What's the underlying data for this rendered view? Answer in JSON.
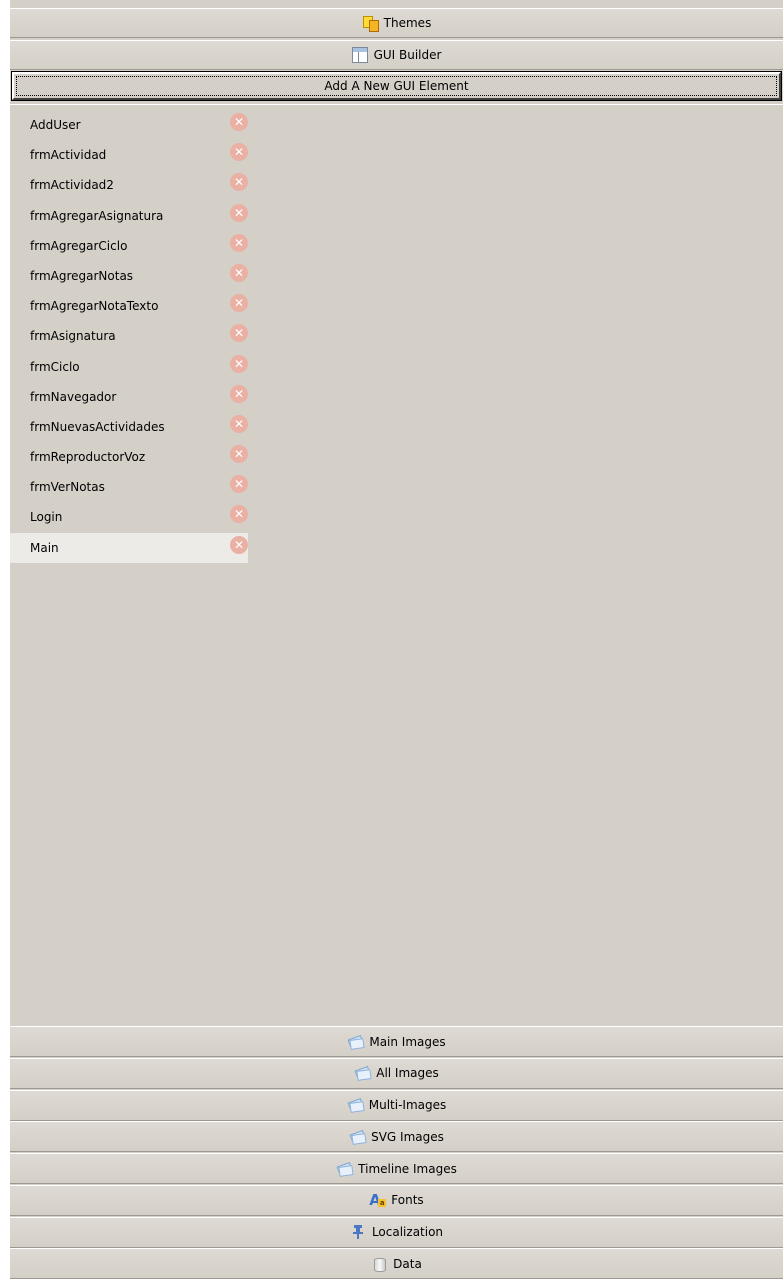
{
  "accordion_top": [
    {
      "key": "themes",
      "label": "Themes",
      "icon": "themes-icon"
    },
    {
      "key": "gui_builder",
      "label": "GUI Builder",
      "icon": "gui-builder-icon"
    }
  ],
  "add_button": {
    "label": "Add A New GUI Element"
  },
  "gui_elements": [
    {
      "label": "AddUser",
      "selected": false
    },
    {
      "label": "frmActividad",
      "selected": false
    },
    {
      "label": "frmActividad2",
      "selected": false
    },
    {
      "label": "frmAgregarAsignatura",
      "selected": false
    },
    {
      "label": "frmAgregarCiclo",
      "selected": false
    },
    {
      "label": "frmAgregarNotas",
      "selected": false
    },
    {
      "label": "frmAgregarNotaTexto",
      "selected": false
    },
    {
      "label": "frmAsignatura",
      "selected": false
    },
    {
      "label": "frmCiclo",
      "selected": false
    },
    {
      "label": "frmNavegador",
      "selected": false
    },
    {
      "label": "frmNuevasActividades",
      "selected": false
    },
    {
      "label": "frmReproductorVoz",
      "selected": false
    },
    {
      "label": "frmVerNotas",
      "selected": false
    },
    {
      "label": "Login",
      "selected": false
    },
    {
      "label": "Main",
      "selected": true
    }
  ],
  "delete_glyph": "✕",
  "accordion_bottom": [
    {
      "key": "main_images",
      "label": "Main Images",
      "icon": "images-icon"
    },
    {
      "key": "all_images",
      "label": "All Images",
      "icon": "images-icon"
    },
    {
      "key": "multi_images",
      "label": "Multi-Images",
      "icon": "images-icon"
    },
    {
      "key": "svg_images",
      "label": "SVG Images",
      "icon": "images-icon"
    },
    {
      "key": "timeline_images",
      "label": "Timeline Images",
      "icon": "images-icon"
    },
    {
      "key": "fonts",
      "label": "Fonts",
      "icon": "fonts-icon"
    },
    {
      "key": "localization",
      "label": "Localization",
      "icon": "pin-icon"
    },
    {
      "key": "data",
      "label": "Data",
      "icon": "data-icon"
    }
  ],
  "colors": {
    "panel_bg": "#d4d0c8",
    "selected_row": "#ecebe7",
    "delete_icon": "#eab0a4"
  }
}
